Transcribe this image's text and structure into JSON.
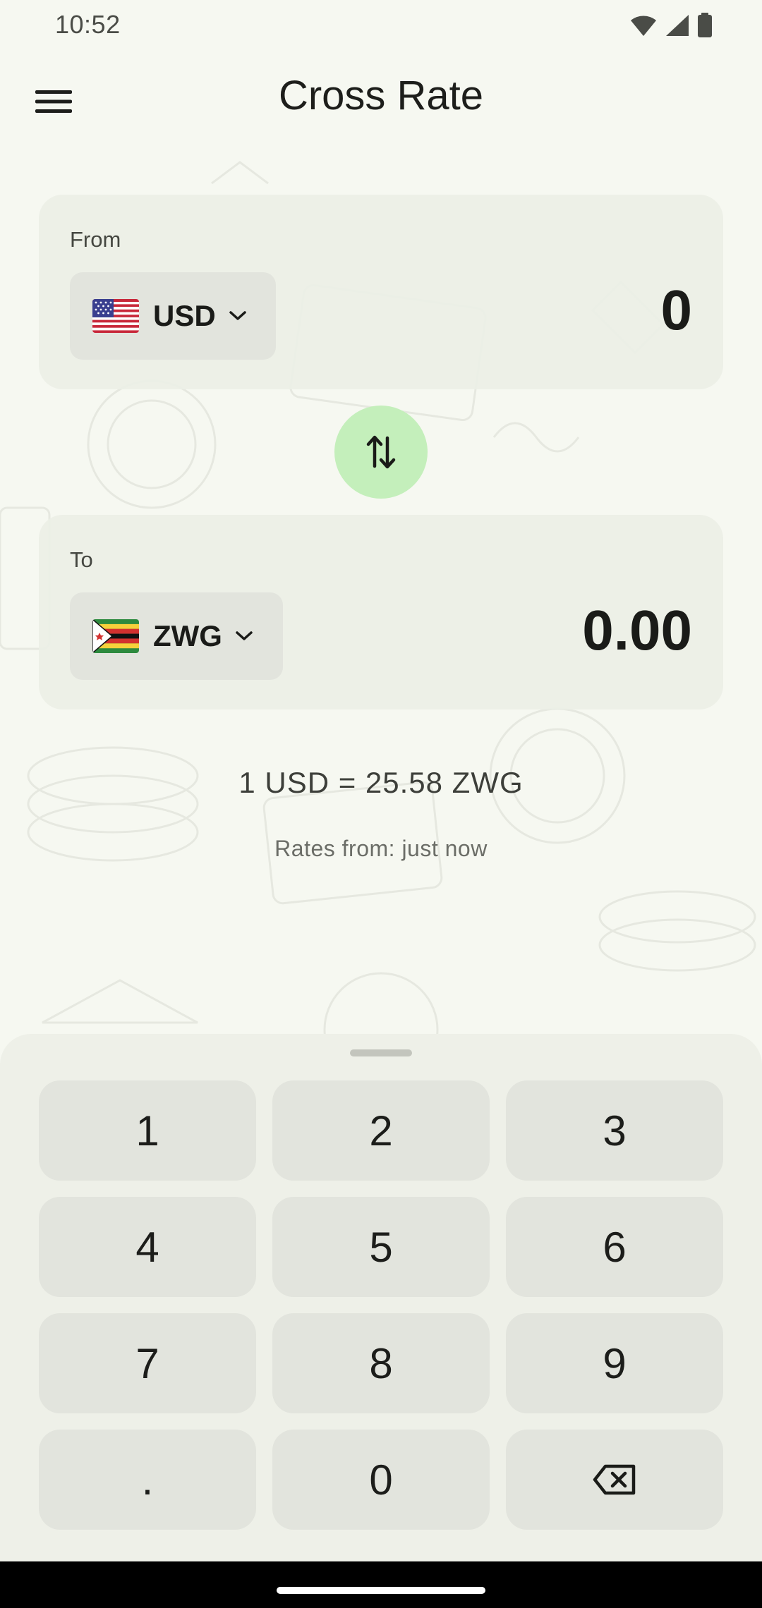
{
  "status_bar": {
    "time": "10:52",
    "icons": [
      "wifi-icon",
      "cellular-signal-icon",
      "battery-icon"
    ]
  },
  "app_bar": {
    "title": "Cross Rate",
    "menu_icon": "hamburger-menu-icon"
  },
  "from_card": {
    "label": "From",
    "currency_code": "USD",
    "flag": "us-flag-icon",
    "amount": "0"
  },
  "swap_button": {
    "icon": "swap-vertical-icon",
    "color": "#c4efbb"
  },
  "to_card": {
    "label": "To",
    "currency_code": "ZWG",
    "flag": "zimbabwe-flag-icon",
    "amount": "0.00"
  },
  "rate": {
    "text": "1 USD = 25.58 ZWG",
    "updated": "Rates from: just now"
  },
  "keypad": {
    "keys": [
      "1",
      "2",
      "3",
      "4",
      "5",
      "6",
      "7",
      "8",
      "9",
      ".",
      "0"
    ],
    "backspace_icon": "backspace-icon"
  },
  "colors": {
    "background": "#f6f8f1",
    "card": "#eceee6",
    "key": "#e2e4dd",
    "accent": "#c4efbb"
  }
}
